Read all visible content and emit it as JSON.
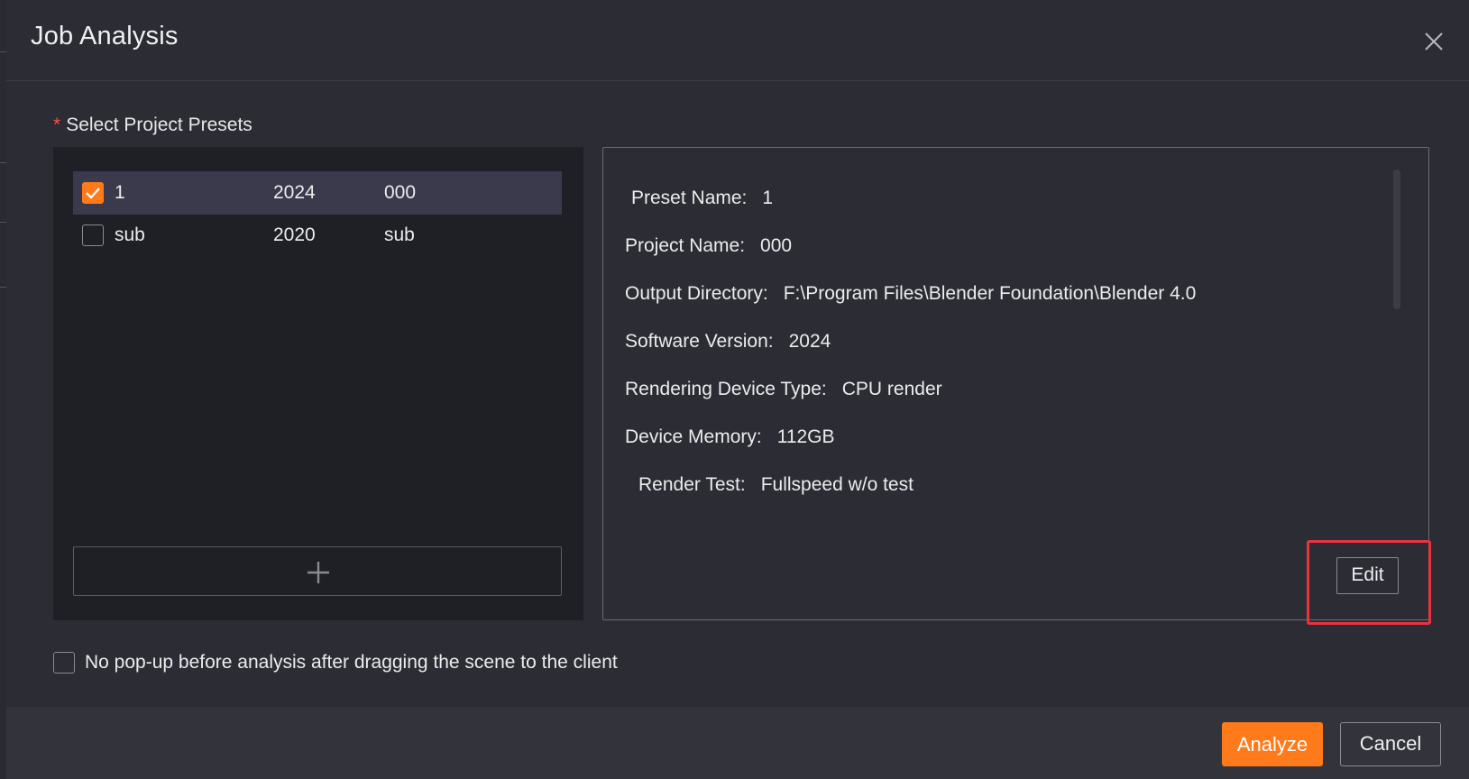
{
  "dialog": {
    "title": "Job Analysis",
    "close_icon": "close-icon"
  },
  "presets": {
    "label": "Select Project Presets",
    "required_marker": "*",
    "rows": [
      {
        "name": "1",
        "version": "2024",
        "project": "000",
        "checked": true,
        "selected": true
      },
      {
        "name": "sub",
        "version": "2020",
        "project": "sub",
        "checked": false,
        "selected": false
      }
    ],
    "add_icon": "plus-icon"
  },
  "details": {
    "rows": [
      {
        "label": "Preset Name:",
        "value": "1"
      },
      {
        "label": "Project Name:",
        "value": "000"
      },
      {
        "label": "Output Directory:",
        "value": "F:\\Program Files\\Blender Foundation\\Blender 4.0"
      },
      {
        "label": "Software Version:",
        "value": "2024"
      },
      {
        "label": "Rendering Device Type:",
        "value": "CPU render"
      },
      {
        "label": "Device Memory:",
        "value": "112GB"
      },
      {
        "label": "Render Test:",
        "value": "Fullspeed w/o test"
      }
    ],
    "edit_label": "Edit"
  },
  "options": {
    "no_popup_label": "No pop-up before analysis after dragging the scene to the client",
    "no_popup_checked": false
  },
  "footer": {
    "analyze_label": "Analyze",
    "cancel_label": "Cancel"
  },
  "colors": {
    "accent": "#ff7a1a",
    "highlight": "#e8343f",
    "background": "#2b2c34"
  }
}
